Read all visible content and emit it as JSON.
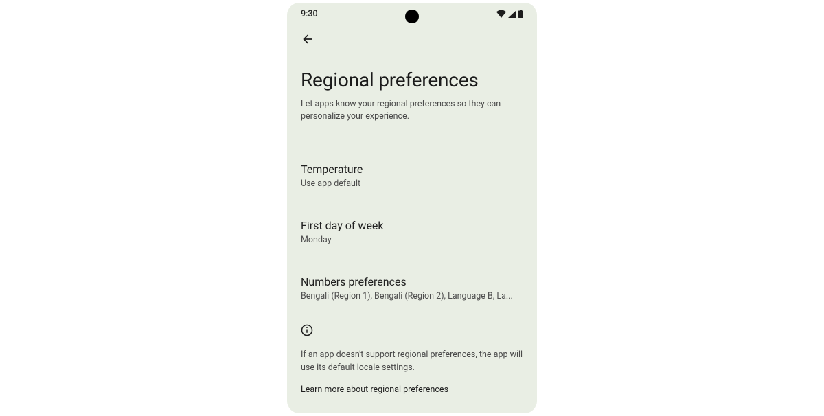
{
  "status_bar": {
    "time": "9:30"
  },
  "page": {
    "title": "Regional preferences",
    "subtitle": "Let apps know your regional preferences so they can personalize your experience."
  },
  "settings": {
    "temperature": {
      "label": "Temperature",
      "value": "Use app default"
    },
    "first_day": {
      "label": "First day of week",
      "value": "Monday"
    },
    "numbers": {
      "label": "Numbers preferences",
      "value": "Bengali (Region 1), Bengali (Region 2), Language B, La..."
    }
  },
  "info": {
    "text": "If an app doesn't support regional preferences, the app will use its default locale settings.",
    "learn_more": "Learn more about regional preferences"
  }
}
